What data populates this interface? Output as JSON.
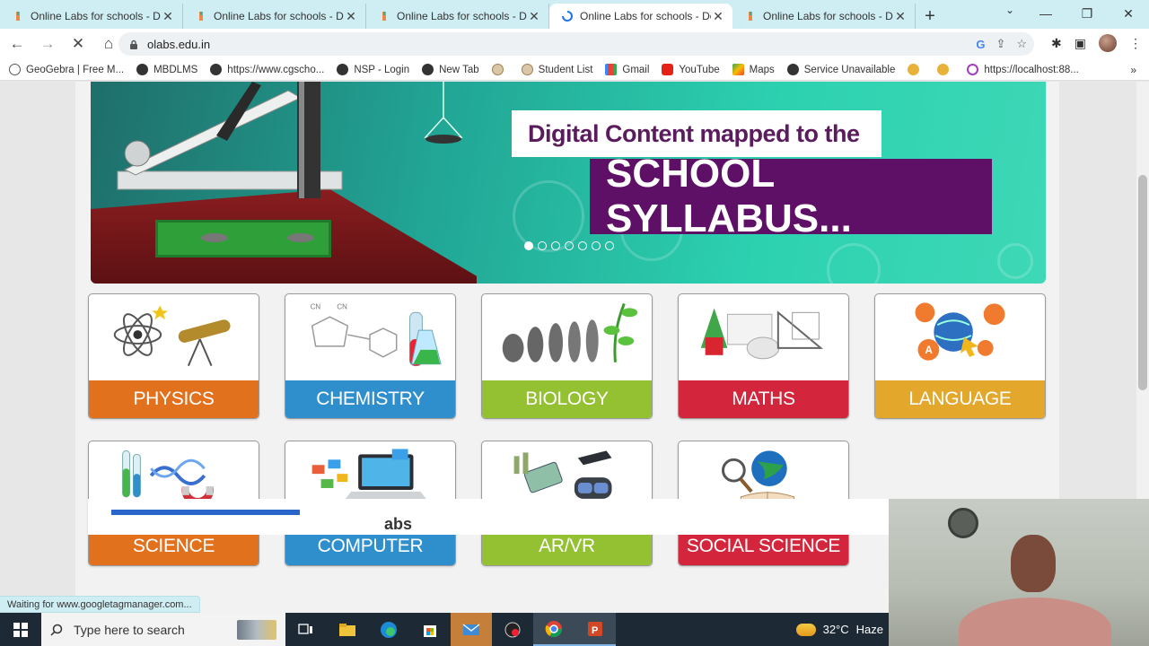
{
  "browser": {
    "tabs": [
      {
        "title": "Online Labs for schools - Dev",
        "active": false
      },
      {
        "title": "Online Labs for schools - Dev",
        "active": false
      },
      {
        "title": "Online Labs for schools - Dev",
        "active": false
      },
      {
        "title": "Online Labs for schools - Dev",
        "active": true
      },
      {
        "title": "Online Labs for schools - Dev",
        "active": false
      }
    ],
    "url": "olabs.edu.in",
    "bookmarks": [
      {
        "label": "GeoGebra | Free M...",
        "icon": "geogebra-icon"
      },
      {
        "label": "MBDLMS",
        "icon": "globe-icon"
      },
      {
        "label": "https://www.cgscho...",
        "icon": "globe-icon"
      },
      {
        "label": "NSP - Login",
        "icon": "globe-icon"
      },
      {
        "label": "New Tab",
        "icon": "globe-icon"
      },
      {
        "label": "",
        "icon": "emblem-icon"
      },
      {
        "label": "Student List",
        "icon": "emblem-icon"
      },
      {
        "label": "Gmail",
        "icon": "gmail-icon"
      },
      {
        "label": "YouTube",
        "icon": "youtube-icon"
      },
      {
        "label": "Maps",
        "icon": "maps-icon"
      },
      {
        "label": "Service Unavailable",
        "icon": "globe-icon"
      },
      {
        "label": "",
        "icon": "face-icon"
      },
      {
        "label": "",
        "icon": "face-icon"
      },
      {
        "label": "https://localhost:88...",
        "icon": "app-icon"
      }
    ]
  },
  "banner": {
    "line1": "Digital Content mapped to the",
    "line2": "SCHOOL SYLLABUS...",
    "slide_count": 7,
    "active_slide": 1
  },
  "subjects": [
    {
      "label": "PHYSICS",
      "color": "#e2711e"
    },
    {
      "label": "CHEMISTRY",
      "color": "#2f8fcd"
    },
    {
      "label": "BIOLOGY",
      "color": "#93c132"
    },
    {
      "label": "MATHS",
      "color": "#d3263c"
    },
    {
      "label": "LANGUAGE",
      "color": "#e2a72b"
    },
    {
      "label": "SCIENCE",
      "color": "#e2711e"
    },
    {
      "label": "COMPUTER",
      "color": "#2f8fcd"
    },
    {
      "label": "AR/VR",
      "color": "#93c132"
    },
    {
      "label": "SOCIAL SCIENCE",
      "color": "#d3263c"
    }
  ],
  "below_heading_fragment": "abs",
  "status_text": "Waiting for www.googletagmanager.com...",
  "taskbar": {
    "search_placeholder": "Type here to search",
    "temperature": "32°C",
    "weather": "Haze"
  }
}
